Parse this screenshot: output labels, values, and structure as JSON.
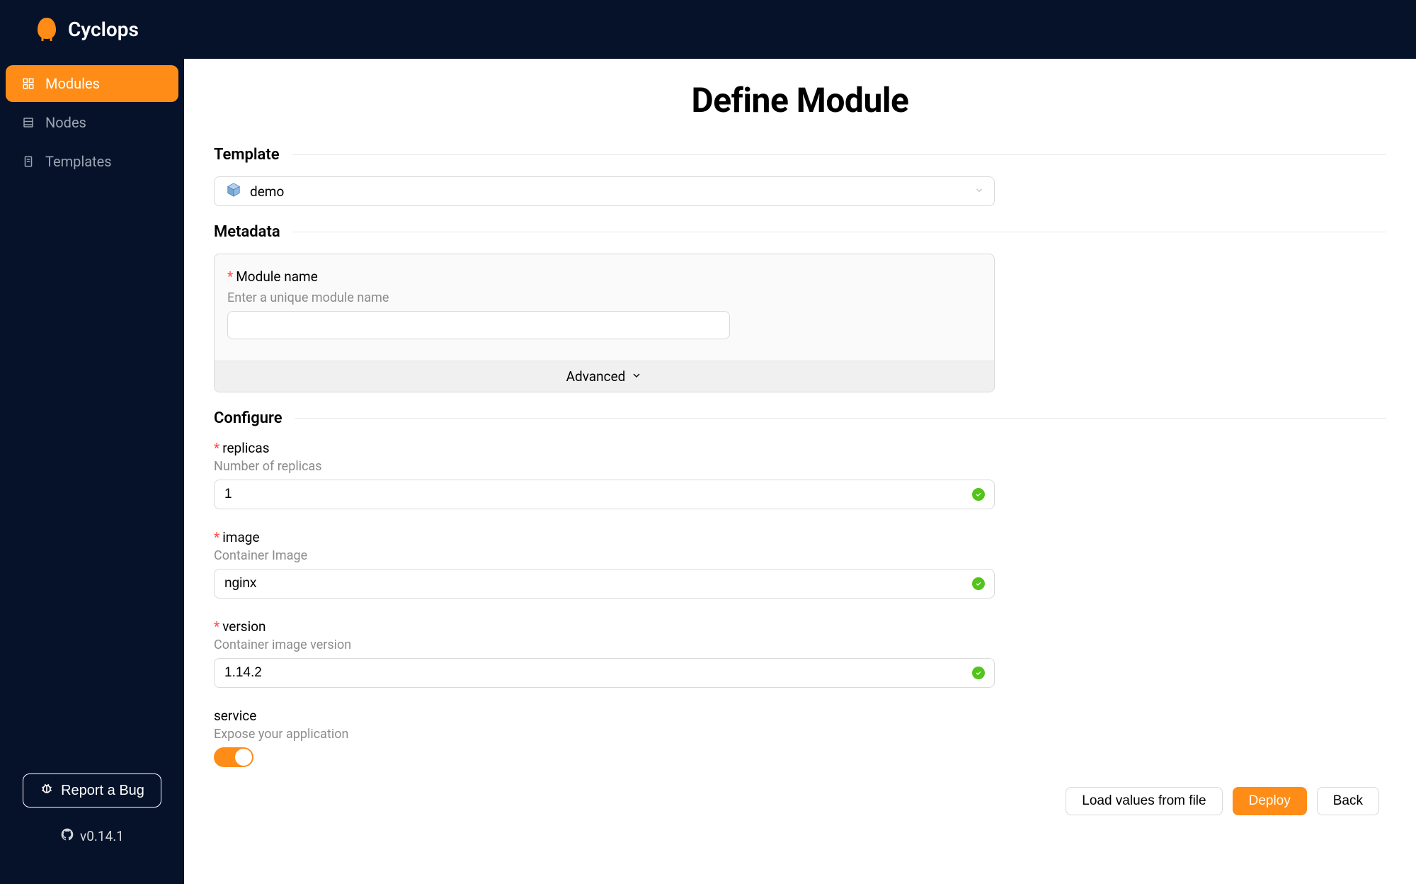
{
  "app": {
    "name": "Cyclops",
    "version": "v0.14.1"
  },
  "sidebar": {
    "items": [
      {
        "label": "Modules",
        "active": true
      },
      {
        "label": "Nodes",
        "active": false
      },
      {
        "label": "Templates",
        "active": false
      }
    ],
    "report_bug": "Report a Bug"
  },
  "page": {
    "title": "Define Module"
  },
  "template_section": {
    "title": "Template",
    "selected": "demo"
  },
  "metadata_section": {
    "title": "Metadata",
    "module_name": {
      "label": "Module name",
      "required": true,
      "description": "Enter a unique module name",
      "value": ""
    },
    "advanced_label": "Advanced"
  },
  "configure_section": {
    "title": "Configure",
    "fields": {
      "replicas": {
        "label": "replicas",
        "required": true,
        "description": "Number of replicas",
        "value": "1",
        "valid": true
      },
      "image": {
        "label": "image",
        "required": true,
        "description": "Container Image",
        "value": "nginx",
        "valid": true
      },
      "version": {
        "label": "version",
        "required": true,
        "description": "Container image version",
        "value": "1.14.2",
        "valid": true
      },
      "service": {
        "label": "service",
        "required": false,
        "description": "Expose your application",
        "value": true
      }
    }
  },
  "footer": {
    "load": "Load values from file",
    "deploy": "Deploy",
    "back": "Back"
  },
  "colors": {
    "primary": "#fe8c16",
    "header_bg": "#06122a",
    "success": "#52c41a",
    "danger": "#ff4d4f"
  }
}
